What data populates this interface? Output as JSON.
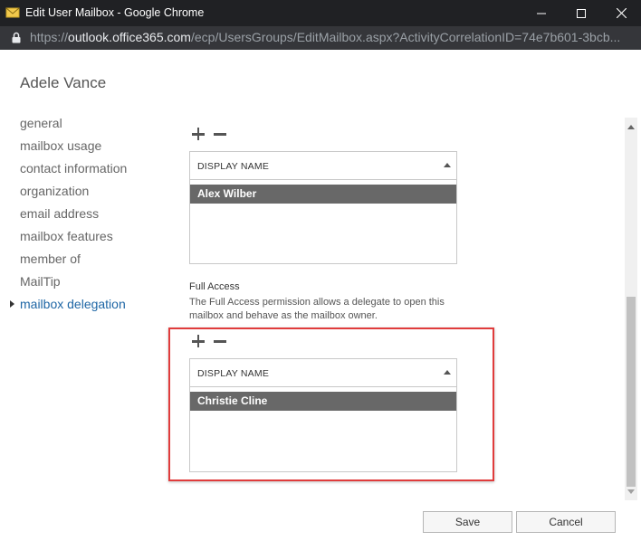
{
  "window": {
    "title": "Edit User Mailbox - Google Chrome"
  },
  "addressbar": {
    "url_scheme": "https://",
    "url_host": "outlook.office365.com",
    "url_path": "/ecp/UsersGroups/EditMailbox.aspx?ActivityCorrelationID=74e7b601-3bcb..."
  },
  "page": {
    "user_name": "Adele Vance"
  },
  "nav": {
    "items": [
      {
        "label": "general"
      },
      {
        "label": "mailbox usage"
      },
      {
        "label": "contact information"
      },
      {
        "label": "organization"
      },
      {
        "label": "email address"
      },
      {
        "label": "mailbox features"
      },
      {
        "label": "member of"
      },
      {
        "label": "MailTip"
      },
      {
        "label": "mailbox delegation"
      }
    ],
    "active_index": 8
  },
  "send_as": {
    "column_header": "DISPLAY NAME",
    "rows": [
      "Alex Wilber"
    ]
  },
  "full_access": {
    "title": "Full Access",
    "description": "The Full Access permission allows a delegate to open this mailbox and behave as the mailbox owner.",
    "column_header": "DISPLAY NAME",
    "rows": [
      "Christie Cline"
    ]
  },
  "footer": {
    "save_label": "Save",
    "cancel_label": "Cancel"
  },
  "colors": {
    "titlebar": "#202124",
    "addressbar": "#35363a",
    "active_nav": "#1e66a5",
    "selected_row": "#686868",
    "highlight_box": "#e03c3c"
  },
  "icons": {
    "app": "outlook-envelope-icon",
    "lock": "lock-icon",
    "add": "plus-icon",
    "remove": "minus-icon",
    "sort": "sort-ascending-icon"
  }
}
